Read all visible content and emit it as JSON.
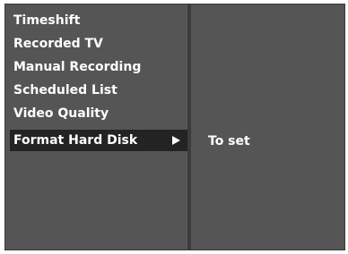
{
  "menu": {
    "items": [
      {
        "label": "Timeshift"
      },
      {
        "label": "Recorded TV"
      },
      {
        "label": "Manual Recording"
      },
      {
        "label": "Scheduled List"
      },
      {
        "label": "Video Quality"
      },
      {
        "label": "Format Hard Disk",
        "selected": true
      }
    ]
  },
  "submenu": {
    "items": [
      {
        "label": "To set"
      }
    ]
  }
}
